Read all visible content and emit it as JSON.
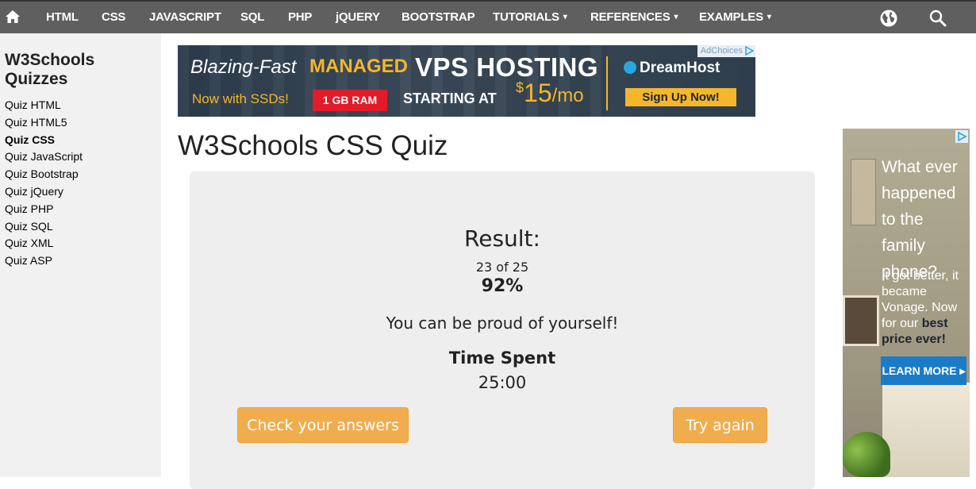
{
  "nav": {
    "items": [
      {
        "label": "HTML"
      },
      {
        "label": "CSS"
      },
      {
        "label": "JAVASCRIPT"
      },
      {
        "label": "SQL"
      },
      {
        "label": "PHP"
      },
      {
        "label": "jQUERY"
      },
      {
        "label": "BOOTSTRAP"
      },
      {
        "label": "TUTORIALS"
      },
      {
        "label": "REFERENCES"
      },
      {
        "label": "EXAMPLES"
      }
    ],
    "caret": "▾",
    "icons": [
      "home-icon",
      "globe-icon",
      "search-icon"
    ]
  },
  "sidebar": {
    "title": "W3Schools Quizzes",
    "items": [
      {
        "label": "Quiz HTML"
      },
      {
        "label": "Quiz HTML5"
      },
      {
        "label": "Quiz CSS",
        "active": true
      },
      {
        "label": "Quiz JavaScript"
      },
      {
        "label": "Quiz Bootstrap"
      },
      {
        "label": "Quiz jQuery"
      },
      {
        "label": "Quiz PHP"
      },
      {
        "label": "Quiz SQL"
      },
      {
        "label": "Quiz XML"
      },
      {
        "label": "Quiz ASP"
      }
    ]
  },
  "ad_top": {
    "adchoices": "AdChoices",
    "line1a": "Blazing-Fast",
    "line1b": "MANAGED",
    "line1c": "VPS HOSTING",
    "line2": "Now with SSDs!",
    "ram": "1 GB RAM",
    "starting": "STARTING AT",
    "price_sup": "$",
    "price": "15",
    "price_unit": "/mo",
    "brand": "DreamHost",
    "cta": "Sign Up Now!"
  },
  "page": {
    "title": "W3Schools CSS Quiz"
  },
  "result": {
    "heading": "Result:",
    "score": "23 of 25",
    "percent": "92%",
    "message": "You can be proud of yourself!",
    "time_label": "Time Spent",
    "time": "25:00",
    "check_button": "Check your answers",
    "try_button": "Try again"
  },
  "ad_right": {
    "headline": "What ever happened to the family phone?",
    "body_start": "It got better, it became Vonage. Now for our",
    "body_bold": "best price ever!",
    "cta": "LEARN MORE ▸"
  },
  "colors": {
    "nav_bg": "#5f5f5f",
    "sidebar_bg": "#f1f1f1",
    "panel_bg": "#eeeeee",
    "button_orange": "#f0ad4e",
    "ad_accent": "#f5b62b",
    "ad_red": "#e21b2a",
    "ad_blue": "#1a7cc7"
  }
}
